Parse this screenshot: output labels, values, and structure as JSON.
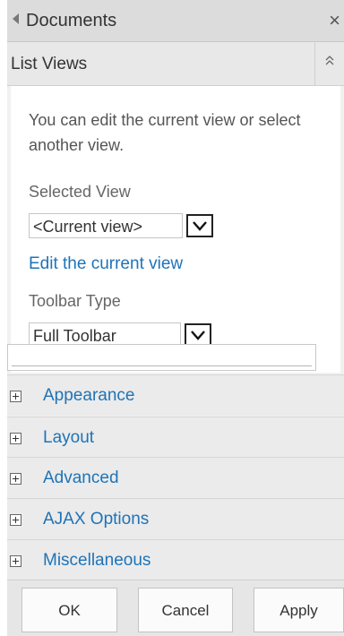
{
  "title_bar": {
    "title": "Documents",
    "back_icon": "left-triangle-icon",
    "close_icon": "close-icon",
    "close_glyph": "×"
  },
  "list_views": {
    "header": "List Views",
    "collapse_glyph": "⌃",
    "description": "You can edit the current view or select another view.",
    "selected_view_label": "Selected View",
    "selected_view_value": "<Current view>",
    "edit_link": "Edit the current view",
    "toolbar_type_label": "Toolbar Type",
    "toolbar_type_value": "Full Toolbar"
  },
  "accordion": [
    {
      "label": "Appearance"
    },
    {
      "label": "Layout"
    },
    {
      "label": "Advanced"
    },
    {
      "label": "AJAX Options"
    },
    {
      "label": "Miscellaneous"
    }
  ],
  "footer": {
    "ok_label": "OK",
    "cancel_label": "Cancel",
    "apply_label": "Apply"
  },
  "colors": {
    "link": "#1f73b7",
    "panel_bg": "#f1f1f1",
    "title_bg": "#dcdcdc"
  }
}
